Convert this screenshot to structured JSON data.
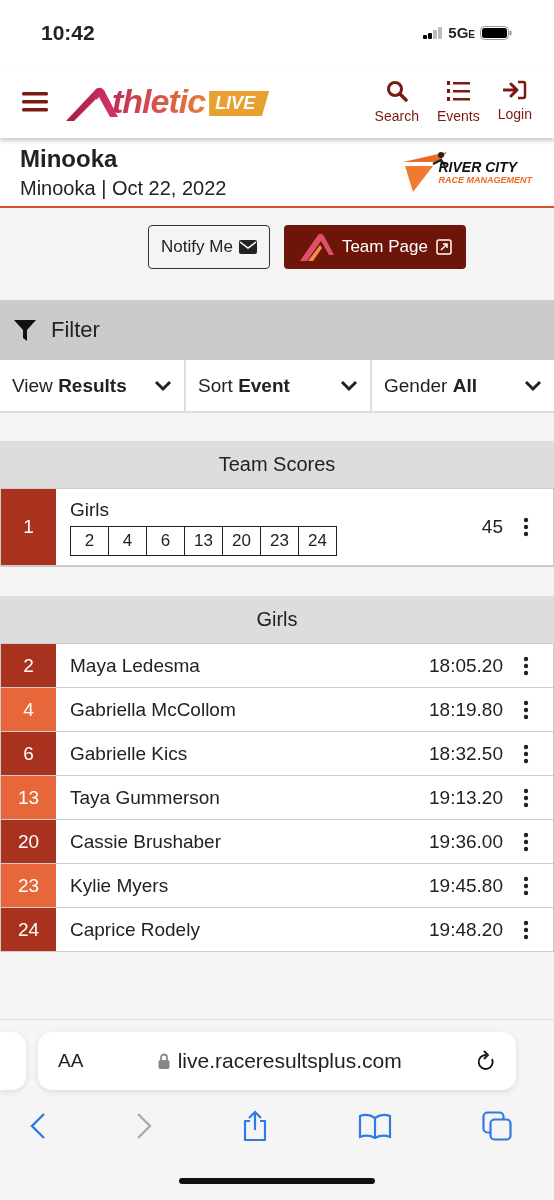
{
  "status_bar": {
    "time": "10:42",
    "network": "5G",
    "network_suffix": "E"
  },
  "header": {
    "logo_text": "thletic",
    "logo_badge": "LIVE",
    "nav": [
      {
        "kind": "search",
        "label": "Search"
      },
      {
        "kind": "events",
        "label": "Events"
      },
      {
        "kind": "login",
        "label": "Login"
      }
    ]
  },
  "event": {
    "title": "Minooka",
    "subtitle": "Minooka | Oct 22, 2022",
    "sponsor_line1": "RIVER CITY",
    "sponsor_line2": "RACE MANAGEMENT"
  },
  "actions": [
    {
      "kind": "notify",
      "label": "Notify Me"
    },
    {
      "kind": "team",
      "label": "Team Page"
    }
  ],
  "filter": {
    "label": "Filter",
    "dropdowns": [
      {
        "prefix": "View",
        "value": "Results"
      },
      {
        "prefix": "Sort",
        "value": "Event"
      },
      {
        "prefix": "Gender",
        "value": "All"
      }
    ]
  },
  "team_scores": {
    "title": "Team Scores",
    "rows": [
      {
        "place": "1",
        "team": "Girls",
        "color": "#a8321e",
        "scorers": [
          "2",
          "4",
          "6",
          "13",
          "20",
          "23",
          "24"
        ],
        "score": "45"
      }
    ]
  },
  "results": {
    "title": "Girls",
    "rows": [
      {
        "place": "2",
        "name": "Maya Ledesma",
        "time": "18:05.20",
        "color": "#a8321e"
      },
      {
        "place": "4",
        "name": "Gabriella McCollom",
        "time": "18:19.80",
        "color": "#e8673a"
      },
      {
        "place": "6",
        "name": "Gabrielle Kics",
        "time": "18:32.50",
        "color": "#a8321e"
      },
      {
        "place": "13",
        "name": "Taya Gummerson",
        "time": "19:13.20",
        "color": "#e8673a"
      },
      {
        "place": "20",
        "name": "Cassie Brushaber",
        "time": "19:36.00",
        "color": "#a8321e"
      },
      {
        "place": "23",
        "name": "Kylie Myers",
        "time": "19:45.80",
        "color": "#e8673a"
      },
      {
        "place": "24",
        "name": "Caprice Rodely",
        "time": "19:48.20",
        "color": "#a8321e"
      }
    ]
  },
  "browser": {
    "text_size": "AA",
    "url": "live.raceresultsplus.com"
  }
}
